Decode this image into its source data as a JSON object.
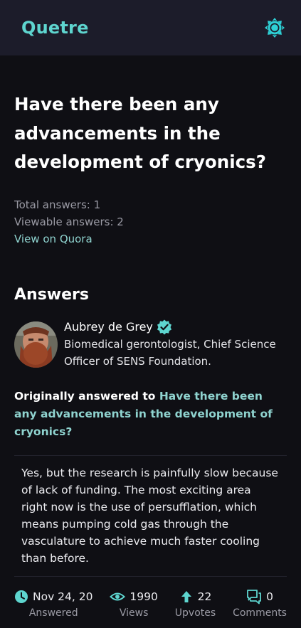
{
  "header": {
    "logo": "Quetre",
    "theme_icon": "sun-gear-icon",
    "accent": "#5ed5cf"
  },
  "question": {
    "title": "Have there been any advancements in the development of cryonics?",
    "total_answers": "Total answers: 1",
    "viewable_answers": "Viewable answers: 2",
    "view_on_quora": "View on Quora"
  },
  "answers_heading": "Answers",
  "answer": {
    "author_name": "Aubrey de Grey",
    "author_credential": "Biomedical gerontologist, Chief Science Officer of SENS Foundation.",
    "orig_prefix": "Originally answered to",
    "orig_question": "Have there been any advancements in the development of cryonics?",
    "body": "Yes, but the research is painfully slow because of lack of funding. The most exciting area right now is the use of persufflation, which means pumping cold gas through the vasculature to achieve much faster cooling than before.",
    "stats": {
      "date": "Nov 24, 20",
      "date_label": "Answered",
      "views": "1990",
      "views_label": "Views",
      "upvotes": "22",
      "upvotes_label": "Upvotes",
      "comments": "0",
      "comments_label": "Comments"
    }
  }
}
